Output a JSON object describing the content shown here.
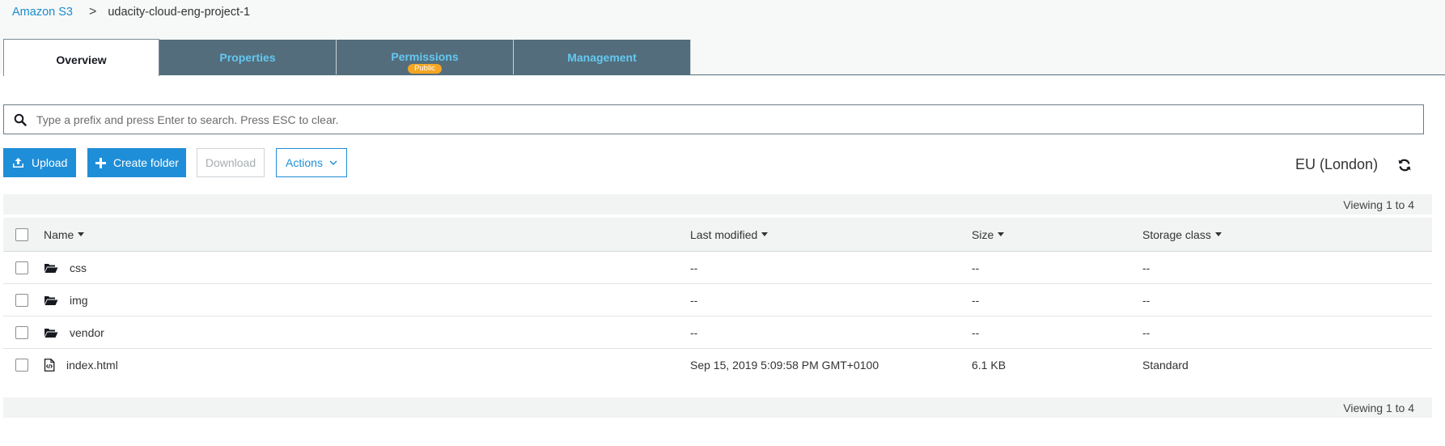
{
  "breadcrumb": {
    "root": "Amazon S3",
    "separator": ">",
    "current": "udacity-cloud-eng-project-1"
  },
  "tabs": [
    {
      "label": "Overview",
      "active": true
    },
    {
      "label": "Properties",
      "active": false
    },
    {
      "label": "Permissions",
      "active": false,
      "badge": "Public"
    },
    {
      "label": "Management",
      "active": false
    }
  ],
  "search": {
    "placeholder": "Type a prefix and press Enter to search. Press ESC to clear.",
    "value": ""
  },
  "toolbar": {
    "upload_label": "Upload",
    "create_folder_label": "Create folder",
    "download_label": "Download",
    "actions_label": "Actions",
    "region": "EU (London)"
  },
  "pagination": {
    "top": "Viewing 1 to 4",
    "bottom": "Viewing 1 to 4"
  },
  "table": {
    "columns": {
      "name": "Name",
      "last_modified": "Last modified",
      "size": "Size",
      "storage_class": "Storage class"
    },
    "rows": [
      {
        "name": "css",
        "type": "folder",
        "last_modified": "--",
        "size": "--",
        "storage_class": "--"
      },
      {
        "name": "img",
        "type": "folder",
        "last_modified": "--",
        "size": "--",
        "storage_class": "--"
      },
      {
        "name": "vendor",
        "type": "folder",
        "last_modified": "--",
        "size": "--",
        "storage_class": "--"
      },
      {
        "name": "index.html",
        "type": "file",
        "last_modified": "Sep 15, 2019 5:09:58 PM GMT+0100",
        "size": "6.1 KB",
        "storage_class": "Standard"
      }
    ]
  },
  "colors": {
    "accent": "#1f8ed8",
    "tab_bg": "#536d7c",
    "tab_text": "#64c8f0",
    "badge": "#f5a623"
  },
  "icons": {
    "search": "search-icon",
    "upload": "upload-icon",
    "create": "plus-icon",
    "actions": "chevron-down-icon",
    "refresh": "refresh-icon",
    "folder": "folder-open-icon",
    "file": "code-file-icon"
  }
}
